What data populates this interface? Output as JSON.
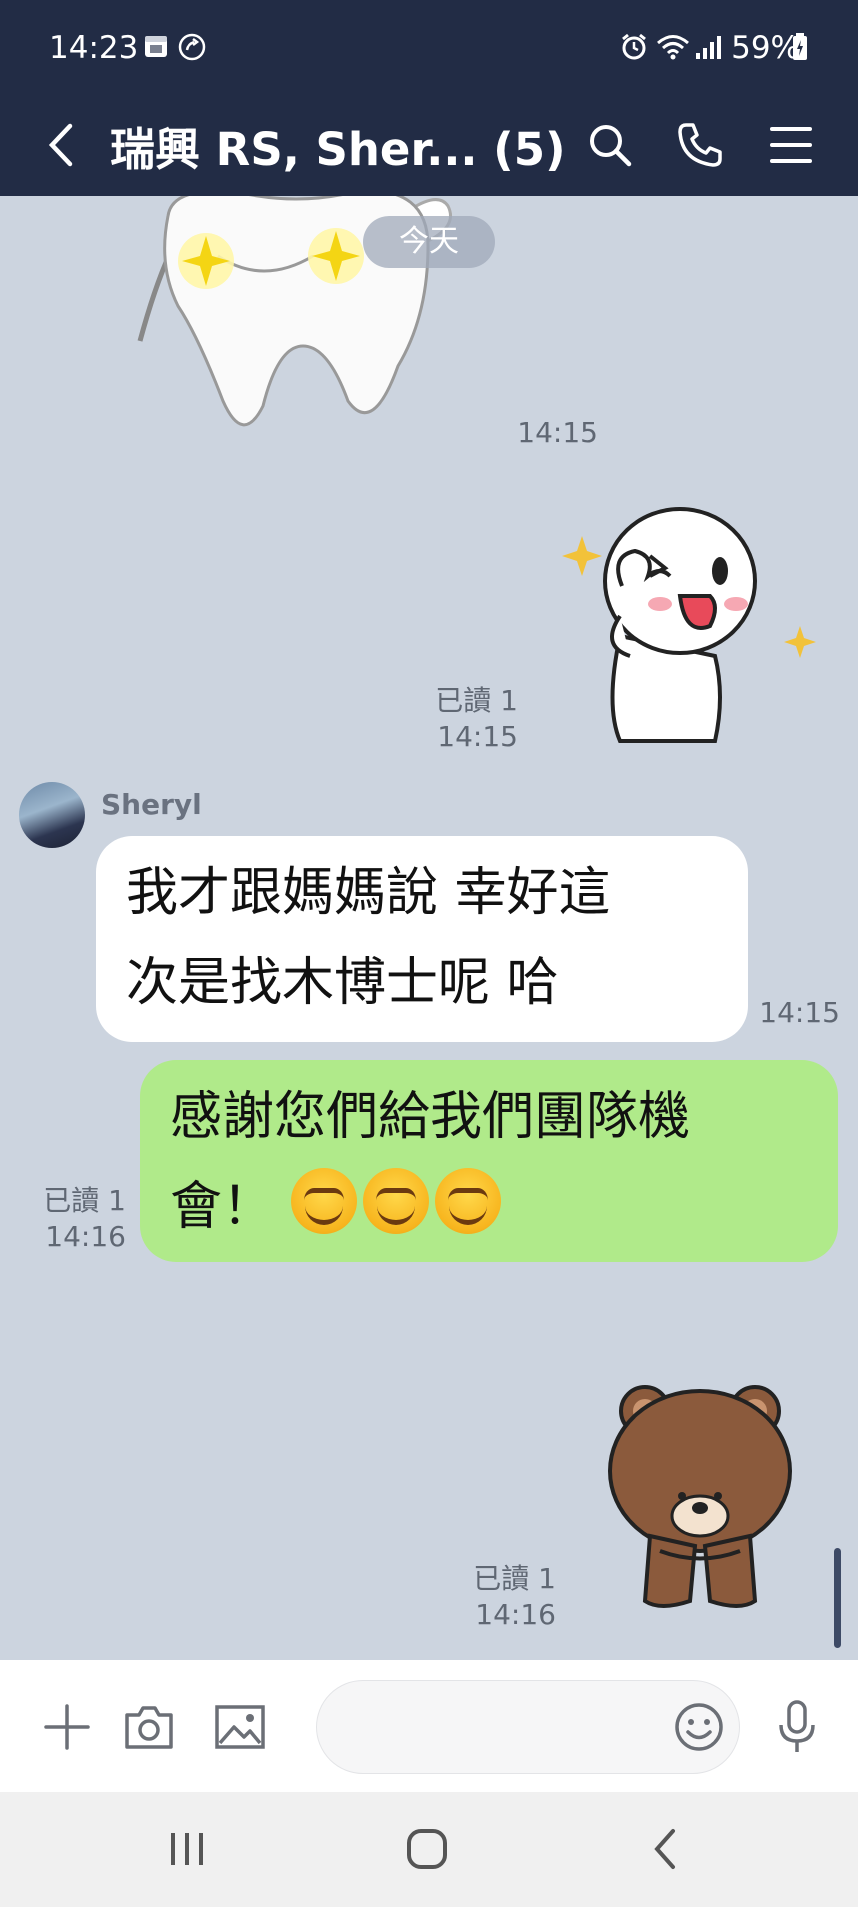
{
  "status_bar": {
    "time": "14:23",
    "battery": "59%",
    "icons": [
      "calendar-icon",
      "call-forward-icon",
      "alarm-icon",
      "wifi-icon",
      "signal-icon",
      "battery-icon"
    ]
  },
  "header": {
    "title": "瑞興 RS, Sher... (5)",
    "icons": [
      "back-icon",
      "search-icon",
      "phone-icon",
      "menu-icon"
    ]
  },
  "chat": {
    "date_divider": "今天",
    "messages": [
      {
        "type": "sticker",
        "sticker": "tooth-sparkle",
        "time": "14:15",
        "direction": "in"
      },
      {
        "type": "sticker",
        "sticker": "cony-wink",
        "read": "已讀 1",
        "time": "14:15",
        "direction": "out"
      },
      {
        "type": "text",
        "sender": "Sheryl",
        "line1": "我才跟媽媽說 幸好這",
        "line2": "次是找木博士呢 哈",
        "time": "14:15",
        "direction": "in"
      },
      {
        "type": "text",
        "line1": "感謝您們給我們團隊機",
        "line2": "會！",
        "emoji": [
          "smiling-face",
          "smiling-face",
          "smiling-face"
        ],
        "read": "已讀 1",
        "time": "14:16",
        "direction": "out"
      },
      {
        "type": "sticker",
        "sticker": "brown-bear-bow",
        "read": "已讀 1",
        "time": "14:16",
        "direction": "out"
      }
    ]
  },
  "input_bar": {
    "placeholder": "",
    "icons": [
      "plus-icon",
      "camera-icon",
      "image-icon",
      "emoji-icon",
      "mic-icon"
    ]
  },
  "nav_bar": {
    "icons": [
      "recent-apps-icon",
      "home-icon",
      "nav-back-icon"
    ]
  },
  "colors": {
    "header_bg": "#222c45",
    "chat_bg": "#ccd4df",
    "outgoing_bubble": "#b0ea8a",
    "incoming_bubble": "#ffffff"
  }
}
